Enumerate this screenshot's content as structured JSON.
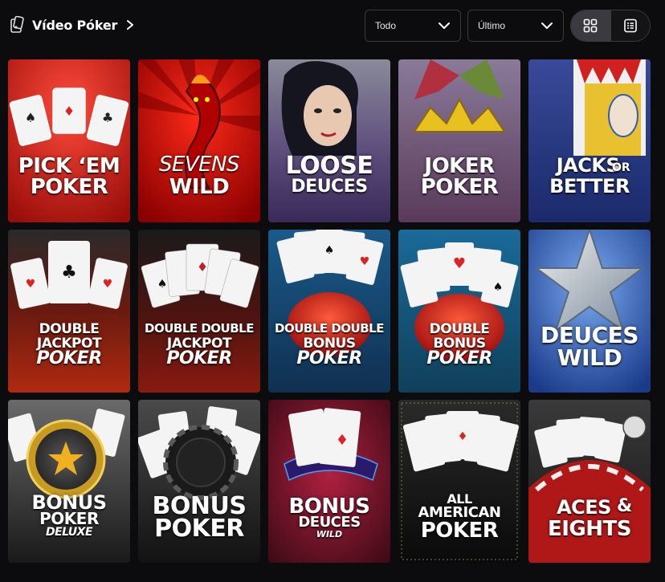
{
  "header": {
    "title": "Vídeo Póker",
    "title_icon": "cards-phone-icon",
    "chevron_icon": "chevron-right-icon"
  },
  "filters": {
    "category": "Todo",
    "sort": "Último"
  },
  "view_toggle": {
    "grid_icon": "grid-view-icon",
    "list_icon": "list-view-icon",
    "active": "grid"
  },
  "games": [
    {
      "id": "pick-em-poker",
      "line1": "PICK ‘EM",
      "line2": "POKER",
      "bg": "#c0201a"
    },
    {
      "id": "sevens-wild",
      "line1": "SEVENS",
      "line2": "WILD",
      "bg": "#e01010"
    },
    {
      "id": "loose-deuces",
      "line1": "LOOSE",
      "line2": "DEUCES",
      "bg": "#5a3a7a"
    },
    {
      "id": "joker-poker",
      "line1": "JOKER",
      "line2": "POKER",
      "bg": "#6a4a6a"
    },
    {
      "id": "jacks-or-better",
      "line1a": "JACKS",
      "line1b": "OR",
      "line2": "BETTER",
      "bg": "#2a3a7a"
    },
    {
      "id": "double-jackpot-poker",
      "line1": "DOUBLE",
      "line2": "JACKPOT",
      "line3": "POKER",
      "bg": "#a0200e"
    },
    {
      "id": "double-double-jackpot-poker",
      "line1": "DOUBLE DOUBLE",
      "line2": "JACKPOT",
      "line3": "POKER",
      "bg": "#7a1a10"
    },
    {
      "id": "double-double-bonus-poker",
      "line1": "DOUBLE DOUBLE",
      "line2": "BONUS",
      "line3": "POKER",
      "bg": "#1a4a7a"
    },
    {
      "id": "double-bonus-poker",
      "line1": "DOUBLE",
      "line2": "BONUS",
      "line3": "POKER",
      "bg": "#1a4a7a"
    },
    {
      "id": "deuces-wild",
      "line1": "DEUCES",
      "line2": "WILD",
      "bg": "#2a5aa8"
    },
    {
      "id": "bonus-poker-deluxe",
      "line1": "BONUS",
      "line2": "POKER",
      "line3": "DELUXE",
      "bg": "#3a3a3a"
    },
    {
      "id": "bonus-poker",
      "line1": "BONUS",
      "line2": "POKER",
      "bg": "#2a2a2a"
    },
    {
      "id": "bonus-deuces-wild",
      "line1": "BONUS",
      "line2": "DEUCES",
      "line3": "WILD",
      "bg": "#6a1020"
    },
    {
      "id": "all-american-poker",
      "line1": "ALL",
      "line2": "AMERICAN",
      "line3": "POKER",
      "bg": "#1a1a1a"
    },
    {
      "id": "aces-and-eights",
      "line1a": "ACES",
      "line1b": "&",
      "line2": "EIGHTS",
      "bg": "#2a2a2a"
    }
  ]
}
